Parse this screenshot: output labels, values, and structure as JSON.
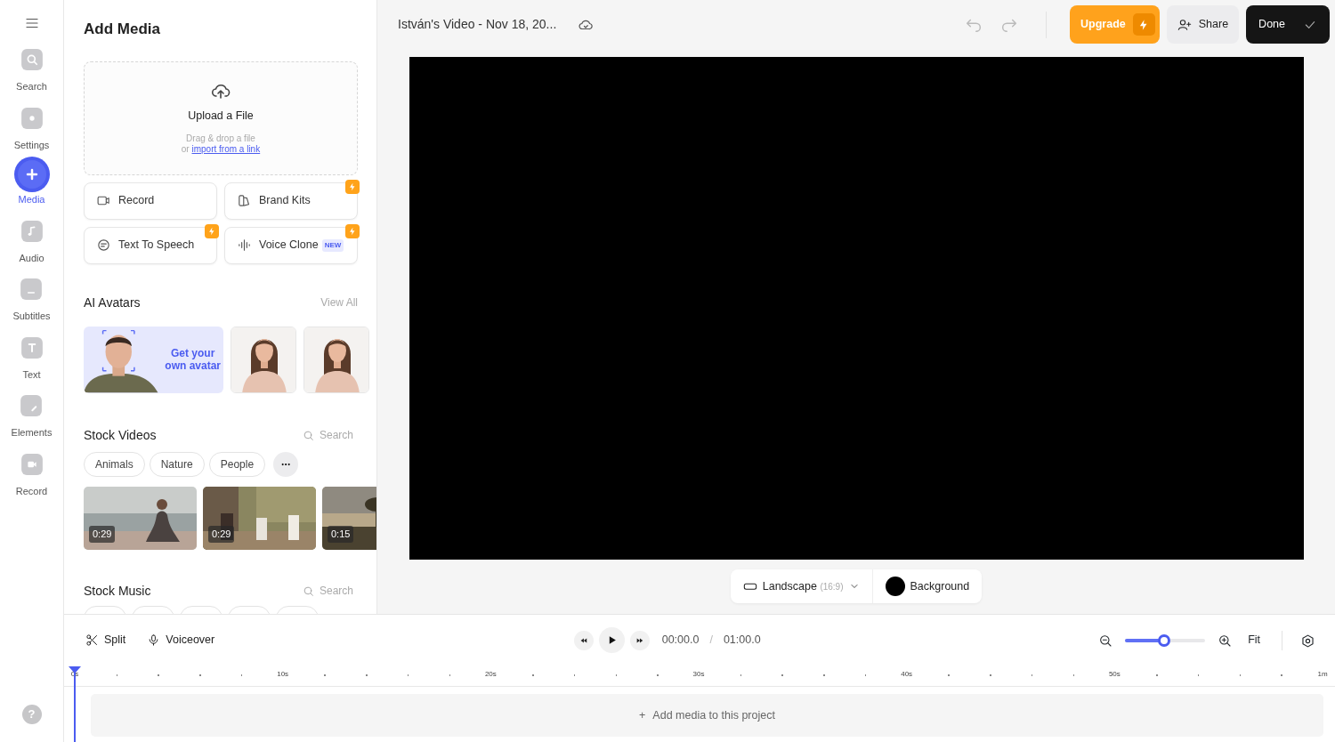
{
  "rail": {
    "items": [
      {
        "kind": "search",
        "label": "Search",
        "selected": false
      },
      {
        "kind": "settings",
        "label": "Settings",
        "selected": false
      },
      {
        "kind": "media",
        "label": "Media",
        "selected": true
      },
      {
        "kind": "audio",
        "label": "Audio",
        "selected": false
      },
      {
        "kind": "subtitles",
        "label": "Subtitles",
        "selected": false
      },
      {
        "kind": "text",
        "label": "Text",
        "selected": false
      },
      {
        "kind": "elements",
        "label": "Elements",
        "selected": false
      },
      {
        "kind": "record",
        "label": "Record",
        "selected": false
      }
    ],
    "help": "?"
  },
  "panel": {
    "title": "Add Media",
    "upload": {
      "title": "Upload a File",
      "hint": "Drag & drop a file",
      "link_prefix": "or",
      "link": "import from a link"
    },
    "actions": [
      {
        "kind": "record",
        "label": "Record",
        "premium": false
      },
      {
        "kind": "brand",
        "label": "Brand Kits",
        "premium": true
      },
      {
        "kind": "speech",
        "label": "Text To Speech",
        "premium": true
      },
      {
        "kind": "voice",
        "label": "Voice Clone",
        "badge": "NEW",
        "premium": true
      }
    ],
    "avatars": {
      "title": "AI Avatars",
      "view_all": "View All",
      "promo": "Get your own avatar"
    },
    "stock_videos": {
      "title": "Stock Videos",
      "search_placeholder": "Search",
      "chips": [
        "Animals",
        "Nature",
        "People"
      ],
      "videos": [
        {
          "kind": "beach",
          "duration": "0:29"
        },
        {
          "kind": "camp",
          "duration": "0:29"
        },
        {
          "kind": "sunset",
          "duration": "0:15"
        }
      ]
    },
    "stock_music": {
      "title": "Stock Music",
      "search_placeholder": "Search"
    }
  },
  "header": {
    "title": "István's Video - Nov 18, 20...",
    "upgrade": "Upgrade",
    "share": "Share",
    "done": "Done"
  },
  "canvas": {
    "format": "Landscape",
    "ratio": "(16:9)",
    "background": "Background"
  },
  "timeline": {
    "split": "Split",
    "voiceover": "Voiceover",
    "current": "00:00.0",
    "separator": "/",
    "total": "01:00.0",
    "zoom": {
      "level": 0.49
    },
    "fit": "Fit",
    "ruler": [
      "0s",
      "10s",
      "20s",
      "30s",
      "40s",
      "50s",
      "1m"
    ],
    "plus": "+",
    "add_media": "Add media to this project"
  }
}
